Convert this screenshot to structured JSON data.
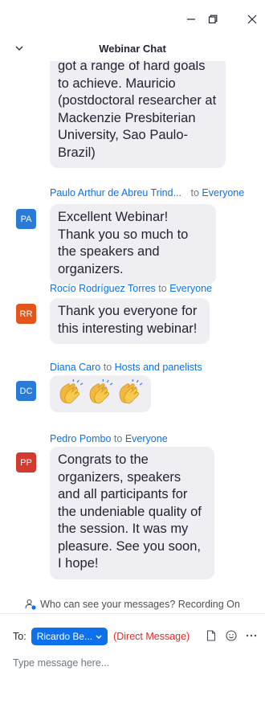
{
  "window": {
    "title": "Webinar Chat"
  },
  "messages": [
    {
      "body": "got a range of hard goals to achieve. Mauricio (postdoctoral researcher at Mackenzie Presbiterian University, Sao Paulo-Brazil)"
    },
    {
      "sender": "Paulo Arthur de Abreu Trind...",
      "to_word": "to",
      "recipient": "Everyone",
      "initials": "PA",
      "avatar_color": "#2b7bd6",
      "body": "Excellent Webinar! Thank you so much to the speakers and organizers."
    },
    {
      "sender": "Rocío Rodríguez Torres",
      "to_word": "to",
      "recipient": "Everyone",
      "initials": "RR",
      "avatar_color": "#e0561b",
      "body": "Thank you everyone for this interesting webinar!"
    },
    {
      "sender": "Diana Caro",
      "to_word": "to",
      "recipient": "Hosts and panelists",
      "initials": "DC",
      "avatar_color": "#2b7bd6",
      "emoji": [
        "clapping-hands",
        "clapping-hands",
        "clapping-hands"
      ]
    },
    {
      "sender": "Pedro Pombo",
      "to_word": "to",
      "recipient": "Everyone",
      "initials": "PP",
      "avatar_color": "#d23a2f",
      "body": "Congrats to the organizers, speakers and all participants for the undeniable quality of the session. It was my pleasure. See you soon, I hope!"
    }
  ],
  "footer": {
    "notice": "Who can see your messages? Recording On",
    "to_label": "To:",
    "recipient_button": "Ricardo Be...",
    "direct_message": "(Direct Message)",
    "input_placeholder": "Type message here..."
  },
  "colors": {
    "accent": "#0e71eb",
    "bubble": "#efeff3",
    "direct_message": "#e02828"
  }
}
